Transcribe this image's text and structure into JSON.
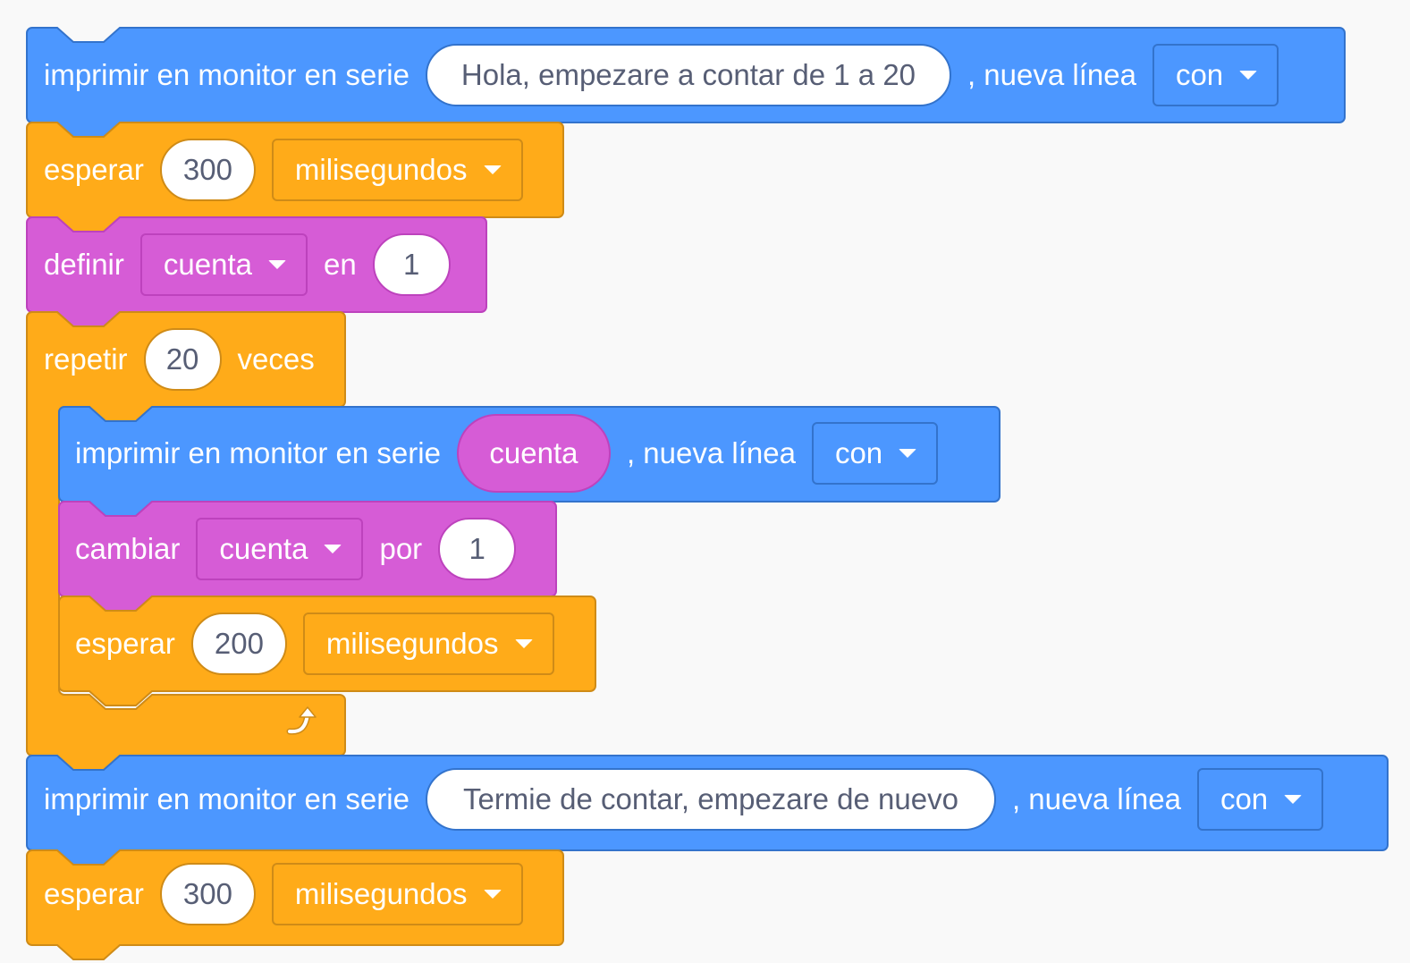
{
  "colors": {
    "looks_blue": "#4c97ff",
    "looks_blue_edge": "#3373cc",
    "control_orange": "#ffab19",
    "control_orange_edge": "#cf8b17",
    "variable_purple": "#d65cd6",
    "variable_purple_edge": "#bd42bd",
    "canvas": "#f9f9f9"
  },
  "blocks": {
    "print1": {
      "label": "imprimir en monitor en serie",
      "text": "Hola, empezare a contar de 1 a 20",
      "newline_label": ", nueva línea",
      "newline_option": "con"
    },
    "wait1": {
      "label": "esperar",
      "value": "300",
      "unit": "milisegundos"
    },
    "set_var": {
      "label": "definir",
      "variable": "cuenta",
      "in_label": "en",
      "value": "1"
    },
    "repeat": {
      "label": "repetir",
      "times": "20",
      "times_label": "veces",
      "loop_icon": "loop-arrow-icon"
    },
    "print2": {
      "label": "imprimir en monitor en serie",
      "reporter": "cuenta",
      "newline_label": ", nueva línea",
      "newline_option": "con"
    },
    "change_var": {
      "label": "cambiar",
      "variable": "cuenta",
      "by_label": "por",
      "value": "1"
    },
    "wait2": {
      "label": "esperar",
      "value": "200",
      "unit": "milisegundos"
    },
    "print3": {
      "label": "imprimir en monitor en serie",
      "text": "Termie de contar, empezare de nuevo",
      "newline_label": ", nueva línea",
      "newline_option": "con"
    },
    "wait3": {
      "label": "esperar",
      "value": "300",
      "unit": "milisegundos"
    }
  }
}
